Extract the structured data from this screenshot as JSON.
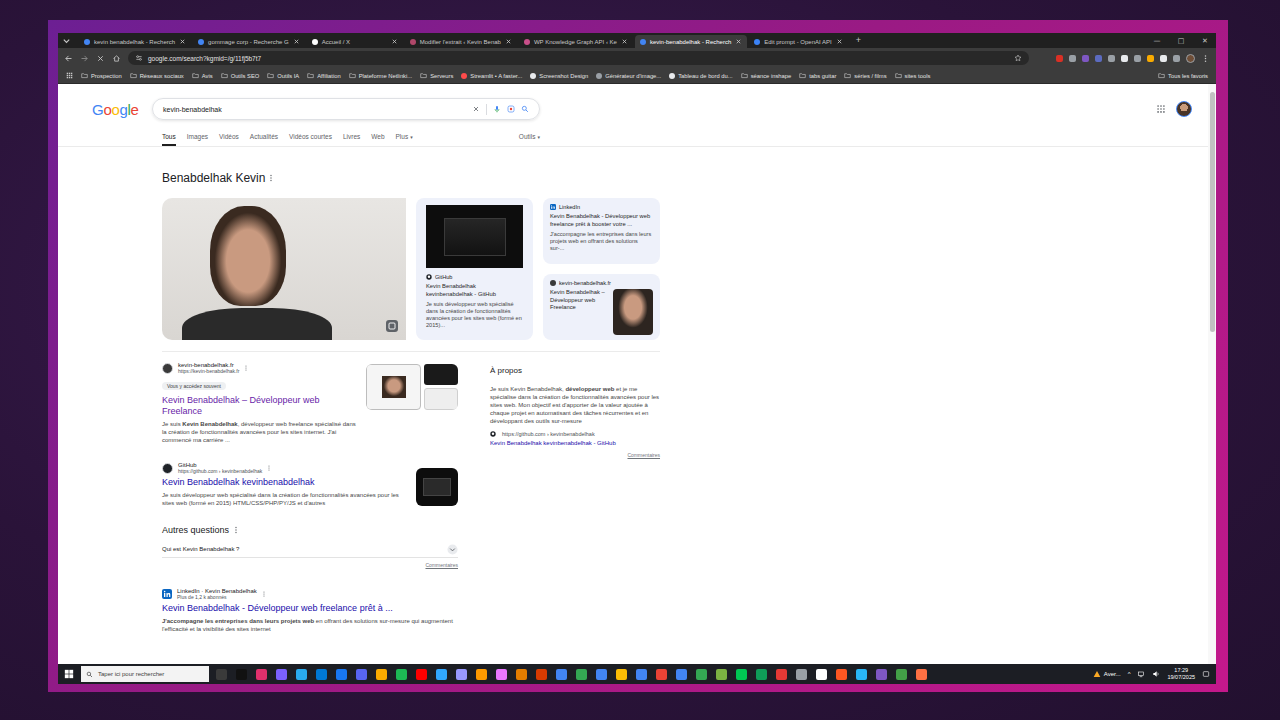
{
  "browser": {
    "tabs": [
      {
        "label": "kevin benabdelhak - Recherch",
        "selected": false,
        "color": "#4285f4"
      },
      {
        "label": "gommage corp - Recherche G",
        "selected": false,
        "color": "#4285f4"
      },
      {
        "label": "Accueil / X",
        "selected": false,
        "color": "#ffffff"
      },
      {
        "label": "Modifier l'extrait ‹ Kevin Benab",
        "selected": false,
        "color": "#b0476a"
      },
      {
        "label": "WP Knowledge Graph API ‹ Ke",
        "selected": false,
        "color": "#c94f8a"
      },
      {
        "label": "kevin-benabdelhak - Recherch",
        "selected": true,
        "color": "#4285f4"
      },
      {
        "label": "Edit prompt - OpenAI API",
        "selected": false,
        "color": "#3b82f6"
      }
    ],
    "new_tab": "+",
    "window_controls": [
      "—",
      "□",
      "✕"
    ],
    "address": "google.com/search?kgmid=/g/11fj5b7t7",
    "extension_colors": [
      "#d93025",
      "#9aa0a6",
      "#7e57c2",
      "#5c6bc0",
      "#9aa0a6",
      "#e8eaed",
      "#9aa0a6",
      "#f9ab00",
      "#e8eaed",
      "#9aa0a6"
    ],
    "bookmarks": [
      {
        "label": "Prospection",
        "kind": "folder"
      },
      {
        "label": "Réseaux sociaux",
        "kind": "folder"
      },
      {
        "label": "Avis",
        "kind": "folder"
      },
      {
        "label": "Outils SEO",
        "kind": "folder"
      },
      {
        "label": "Outils IA",
        "kind": "folder"
      },
      {
        "label": "Affiliation",
        "kind": "folder"
      },
      {
        "label": "Plateforme Netlinki...",
        "kind": "folder"
      },
      {
        "label": "Serveurs",
        "kind": "folder"
      },
      {
        "label": "Streamlit • A faster...",
        "kind": "link",
        "color": "#ff4b4b"
      },
      {
        "label": "Screenshot Design",
        "kind": "link",
        "color": "#e8eaed"
      },
      {
        "label": "Générateur d'image...",
        "kind": "link",
        "color": "#9aa0a6"
      },
      {
        "label": "Tableau de bord du...",
        "kind": "link",
        "color": "#e8eaed"
      },
      {
        "label": "séance inshape",
        "kind": "folder"
      },
      {
        "label": "tabs guitar",
        "kind": "folder"
      },
      {
        "label": "séries / films",
        "kind": "folder"
      },
      {
        "label": "sites tools",
        "kind": "folder"
      }
    ],
    "all_bookmarks": "Tous les favoris"
  },
  "google": {
    "logo": "Google",
    "query": "kevin-benabdelhak",
    "nav": [
      {
        "label": "Tous",
        "selected": true
      },
      {
        "label": "Images",
        "selected": false
      },
      {
        "label": "Vidéos",
        "selected": false
      },
      {
        "label": "Actualités",
        "selected": false
      },
      {
        "label": "Vidéos courtes",
        "selected": false
      },
      {
        "label": "Livres",
        "selected": false
      },
      {
        "label": "Web",
        "selected": false
      },
      {
        "label": "Plus",
        "selected": false
      }
    ],
    "more_caret": "▾",
    "tools": "Outils",
    "tools_caret": "▾",
    "knowledge_panel": {
      "title": "Benabdelhak Kevin",
      "github_card": {
        "source": "GitHub",
        "title": "Kevin Benabdelhak kevinbenabdelhak - GitHub",
        "snippet": "Je suis développeur web spécialisé dans la création de fonctionnalités avancées pour les sites web (formé en 2015)..."
      },
      "linkedin_card": {
        "source": "LinkedIn",
        "title": "Kevin Benabdelhak - Développeur web freelance prêt à booster votre ...",
        "snippet": "J'accompagne les entreprises dans leurs projets web en offrant des solutions sur-..."
      },
      "site_card": {
        "source": "kevin-benabdelhak.fr",
        "title": "Kevin Benabdelhak – Développeur web Freelance"
      }
    },
    "results_top": [
      {
        "site": "kevin-benabdelhak.fr",
        "url": "https://kevin-benabdelhak.fr",
        "badge": "Vous y accédez souvent",
        "title": "Kevin Benabdelhak – Développeur web Freelance",
        "visited": true,
        "color": "#3a3a3a",
        "thumbnail": "site",
        "snippet": [
          {
            "text": "Je suis ",
            "bold": false
          },
          {
            "text": "Kevin Benabdelhak",
            "bold": true
          },
          {
            "text": ", développeur web freelance spécialisé dans la création de fonctionnalités avancées pour les sites internet. J'ai commencé ma carrière ...",
            "bold": false
          }
        ]
      },
      {
        "site": "GitHub",
        "url": "https://github.com › kevinbenabdelhak",
        "title": "Kevin Benabdelhak kevinbenabdelhak",
        "visited": false,
        "color": "#1f2328",
        "thumbnail": "dark",
        "snippet": [
          {
            "text": "Je suis développeur web spécialisé dans la création de fonctionnalités avancées pour les sites web (formé en 2015) HTML/CSS/PHP/PY/JS et d'autres",
            "bold": false
          }
        ]
      }
    ],
    "questions": {
      "heading": "Autres questions",
      "items": [
        {
          "text": "Qui est Kevin Benabdelhak ?",
          "expanded": false
        }
      ],
      "feedback": "Commentaires"
    },
    "results_bottom": [
      {
        "site": "LinkedIn · Kevin Benabdelhak",
        "followers": "Plus de 1,2 k abonnés",
        "title": "Kevin Benabdelhak - Développeur web freelance prêt à ...",
        "visited": false,
        "color": "#0a66c2",
        "snippet": [
          {
            "text": "J'accompagne les entreprises dans leurs projets web",
            "bold": true
          },
          {
            "text": " en offrant des solutions sur-mesure qui augmentent l'efficacité et la visibilité des sites internet",
            "bold": false
          }
        ]
      }
    ],
    "about": {
      "heading": "À propos",
      "text": [
        {
          "text": "Je suis Kevin Benabdelhak, ",
          "bold": false
        },
        {
          "text": "développeur web",
          "bold": true
        },
        {
          "text": " et je me spécialise dans la création de fonctionnalités avancées pour les sites web. Mon objectif est d'apporter de la valeur ajoutée à chaque projet en automatisant des tâches récurrentes et en développant des outils sur-mesure",
          "bold": false
        }
      ],
      "source_url": "https://github.com › kevinbenabdelhak",
      "link": "Kevin Benabdelhak kevinbenabdelhak - GitHub",
      "feedback": "Commentaires"
    }
  },
  "taskbar": {
    "search_placeholder": "Taper ici pour rechercher",
    "apps": [
      "#3a3a3a",
      "#111111",
      "#e1306c",
      "#7b61ff",
      "#2aabee",
      "#0078d4",
      "#1877f2",
      "#5865f2",
      "#f9ab00",
      "#1db954",
      "#ff0000",
      "#31a8ff",
      "#9999ff",
      "#ff9a00",
      "#ea77ff",
      "#e37d00",
      "#d83b01",
      "#4285f4",
      "#34a853",
      "#4285f4",
      "#fbbc05",
      "#4285f4",
      "#ea4335",
      "#4285f4",
      "#34a853",
      "#7cb342",
      "#00c853",
      "#0f9d58",
      "#e53935",
      "#9aa0a6",
      "#ffffff",
      "#ff5722",
      "#29b6f6",
      "#7e57c2",
      "#43a047",
      "#ff7043"
    ],
    "weather": "Aver...",
    "tray_caret": "^",
    "time": "17:29",
    "date": "19/07/2025"
  }
}
